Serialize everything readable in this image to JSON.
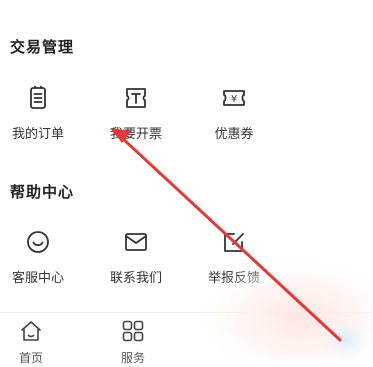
{
  "sections": [
    {
      "title": "交易管理",
      "items": [
        {
          "label": "我的订单",
          "icon": "order-list-icon"
        },
        {
          "label": "我要开票",
          "icon": "invoice-icon"
        },
        {
          "label": "优惠券",
          "icon": "coupon-icon"
        }
      ]
    },
    {
      "title": "帮助中心",
      "items": [
        {
          "label": "客服中心",
          "icon": "customer-service-icon"
        },
        {
          "label": "联系我们",
          "icon": "mail-icon"
        },
        {
          "label": "举报反馈",
          "icon": "feedback-edit-icon"
        }
      ]
    }
  ],
  "bottom_nav": {
    "items": [
      {
        "label": "首页",
        "icon": "home-icon"
      },
      {
        "label": "服务",
        "icon": "grid-icon"
      }
    ]
  },
  "annotation": {
    "arrow_color": "#e53935"
  }
}
